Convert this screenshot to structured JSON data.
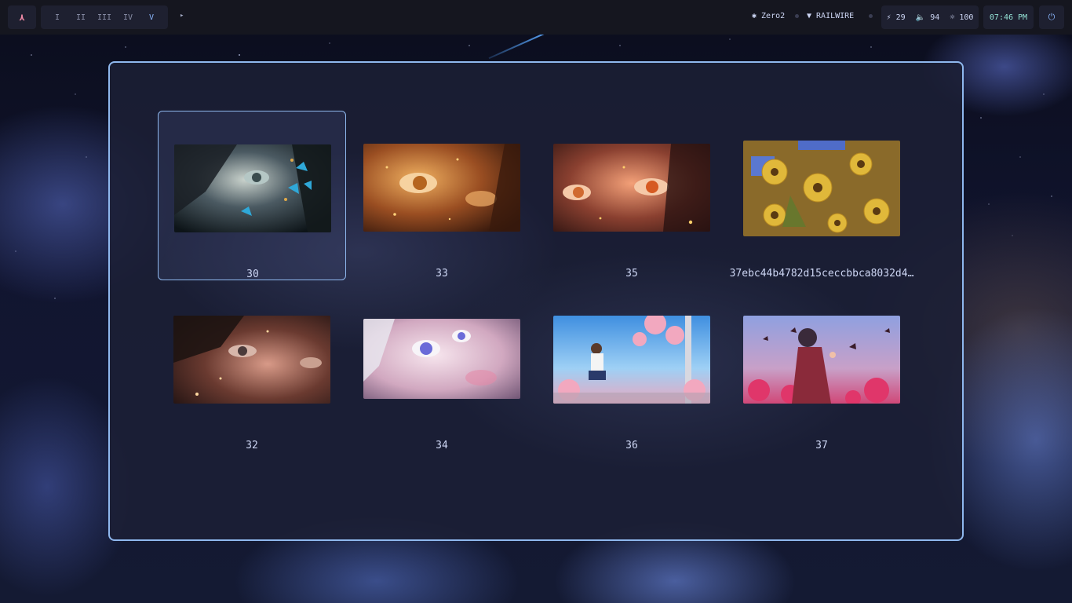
{
  "topbar": {
    "logo_glyph": "⋏",
    "workspaces": [
      "I",
      "II",
      "III",
      "IV",
      "V"
    ],
    "active_workspace": "V",
    "arrow_glyph": "▸",
    "bluetooth": {
      "icon": "bluetooth-icon",
      "label": "✱ Zero2"
    },
    "network": {
      "icon": "wifi-icon",
      "label": "▼ RAILWIRE"
    },
    "stats": {
      "battery": "⚡ 29",
      "volume": "🔈 94",
      "brightness": "☼ 100"
    },
    "clock": "07:46 PM",
    "power_glyph": "⏻"
  },
  "picker": {
    "accent": "#8fb8ee",
    "wallpapers": [
      {
        "label": "30",
        "selected": true,
        "thumb": "anime-girl-blue-butterflies"
      },
      {
        "label": "33",
        "selected": false,
        "thumb": "anime-eye-golden-light"
      },
      {
        "label": "35",
        "selected": false,
        "thumb": "anime-eyes-orange-glow"
      },
      {
        "label": "37ebc44b4782d15ceccbbca8032d4…",
        "selected": false,
        "thumb": "sunflowers"
      },
      {
        "label": "32",
        "selected": false,
        "thumb": "anime-eye-dark-hair-sparkles"
      },
      {
        "label": "34",
        "selected": false,
        "thumb": "anime-girl-white-hair-violet-eyes"
      },
      {
        "label": "36",
        "selected": false,
        "thumb": "girl-sitting-cherry-blossom-window"
      },
      {
        "label": "37",
        "selected": false,
        "thumb": "girl-butterflies-pink-flowers"
      }
    ]
  }
}
